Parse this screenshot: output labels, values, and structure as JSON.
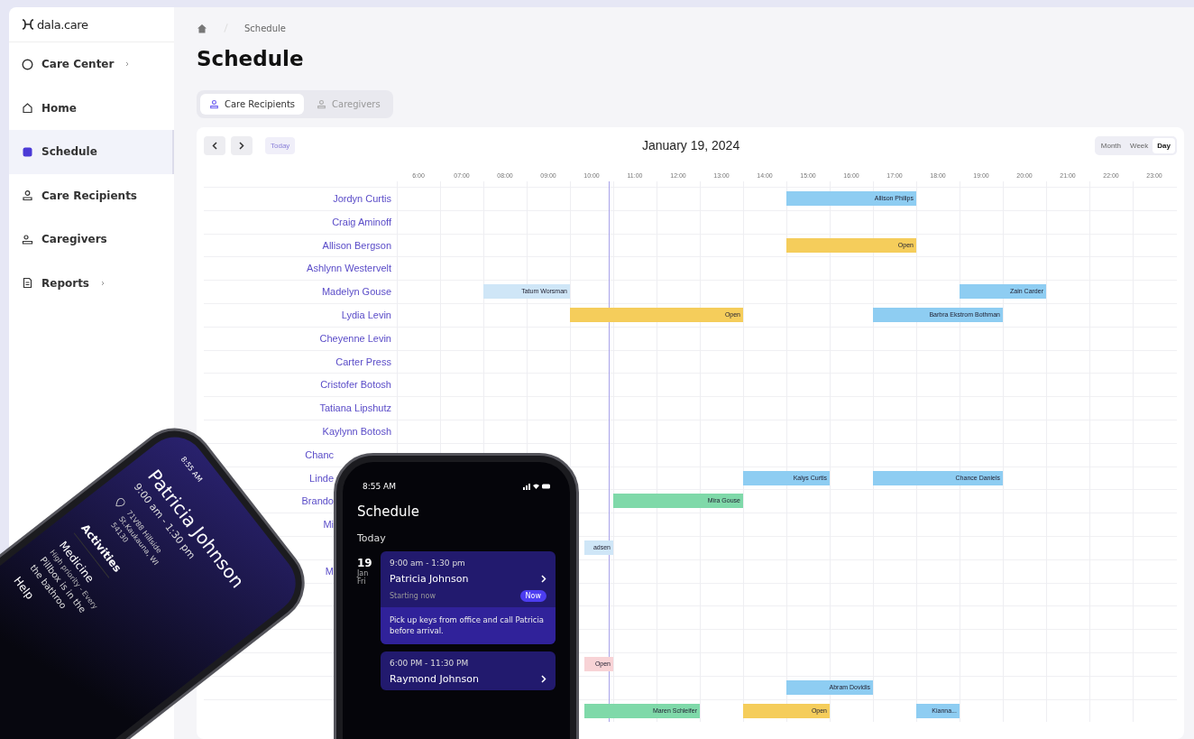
{
  "sidebar": {
    "logo": "dala.care",
    "items": [
      {
        "label": "Care Center",
        "selected": false,
        "submenu": true
      },
      {
        "label": "Home",
        "selected": false,
        "submenu": false
      },
      {
        "label": "Schedule",
        "selected": true,
        "submenu": false
      },
      {
        "label": "Care Recipients",
        "selected": false,
        "submenu": false
      },
      {
        "label": "Caregivers",
        "selected": false,
        "submenu": false
      },
      {
        "label": "Reports",
        "selected": false,
        "submenu": true
      }
    ]
  },
  "breadcrumb": [
    "Schedule"
  ],
  "title": "Schedule",
  "tabs": [
    {
      "label": "Care Recipients",
      "selected": true
    },
    {
      "label": "Caregivers",
      "selected": false
    }
  ],
  "calendar": {
    "today_button": "Today",
    "date": "January 19, 2024",
    "views": [
      {
        "label": "Month",
        "selected": false
      },
      {
        "label": "Week",
        "selected": false
      },
      {
        "label": "Day",
        "selected": true
      }
    ],
    "hours": [
      "6:00",
      "07:00",
      "08:00",
      "09:00",
      "10:00",
      "11:00",
      "12:00",
      "13:00",
      "14:00",
      "15:00",
      "16:00",
      "17:00",
      "18:00",
      "19:00",
      "20:00",
      "21:00",
      "22:00",
      "23:00"
    ],
    "now_marker": {
      "level": 0.272
    },
    "rows": [
      {
        "name": "Jordyn Curtis",
        "events": [
          {
            "label": "Allison Philips",
            "color": "#8ecdf2"
          }
        ]
      },
      {
        "name": "Craig Aminoff",
        "events": []
      },
      {
        "name": "Allison Bergson",
        "events": [
          {
            "label": "Open",
            "color": "#f5cd5b"
          }
        ]
      },
      {
        "name": "Ashlynn Westervelt",
        "events": []
      },
      {
        "name": "Madelyn Gouse",
        "events": [
          {
            "label": "Tatum Worsman",
            "color": "#cfe6f7"
          },
          {
            "label": "Zain Carder",
            "color": "#8ecdf2"
          }
        ]
      },
      {
        "name": "Lydia Levin",
        "events": [
          {
            "label": "Open",
            "color": "#f5cd5b"
          },
          {
            "label": "Barbra Ekstrom Bothman",
            "color": "#8ecdf2"
          }
        ]
      },
      {
        "name": "Cheyenne Levin",
        "events": []
      },
      {
        "name": "Carter Press",
        "events": []
      },
      {
        "name": "Cristofer Botosh",
        "events": []
      },
      {
        "name": "Tatiana Lipshutz",
        "events": []
      },
      {
        "name": "Kaylynn Botosh",
        "events": []
      },
      {
        "name": "Chanc",
        "events": []
      },
      {
        "name": "Linde",
        "events": [
          {
            "label": "Kalys Curtis",
            "color": "#8ecdf2"
          },
          {
            "label": "Chance Daniels",
            "color": "#8ecdf2"
          }
        ]
      },
      {
        "name": "Brando",
        "events": [
          {
            "label": "Mira Gouse",
            "color": "#7fd9a9"
          }
        ]
      },
      {
        "name": "Mi",
        "events": []
      },
      {
        "events": [
          {
            "label": "adsen",
            "color": "#cfe6f7"
          }
        ]
      },
      {
        "name": "M",
        "events": []
      },
      {
        "events": []
      },
      {
        "events": []
      },
      {
        "events": []
      },
      {
        "events": [
          {
            "label": "Open",
            "color": "#f8d3d6"
          }
        ]
      },
      {
        "events": [
          {
            "label": "Abram Dovidis",
            "color": "#8ecdf2"
          }
        ]
      },
      {
        "events": [
          {
            "label": "Maren Schleifer",
            "color": "#7fd9a9"
          },
          {
            "label": "Open",
            "color": "#f5cd5b"
          },
          {
            "label": "Kianna...",
            "color": "#8ecdf2"
          }
        ]
      }
    ]
  },
  "phone_detail": {
    "time": "8:55 AM",
    "name": "Patricia Johnson",
    "hours": "9:00 am - 1:30 pm",
    "address": [
      "71V88 Hillside",
      "St.Kaukauna, WI",
      "54130"
    ],
    "section": "Activities",
    "activity": "Medicine",
    "activity_note": "High priority - Every",
    "lines": [
      "Pillbox is in the",
      "the bathroo"
    ],
    "next": "Help"
  },
  "phone_schedule": {
    "time": "8:55 AM",
    "title": "Schedule",
    "day_heading": "Today",
    "day": "19",
    "month": "Jan",
    "weekday": "Fri",
    "shifts": [
      {
        "time": "9:00 am - 1:30 pm",
        "name": "Patricia Johnson",
        "status": "Starting now",
        "badge": "Now",
        "note": "Pick up keys from office and call Patricia before arrival."
      },
      {
        "time": "6:00 PM - 11:30 PM",
        "name": "Raymond Johnson"
      }
    ]
  }
}
